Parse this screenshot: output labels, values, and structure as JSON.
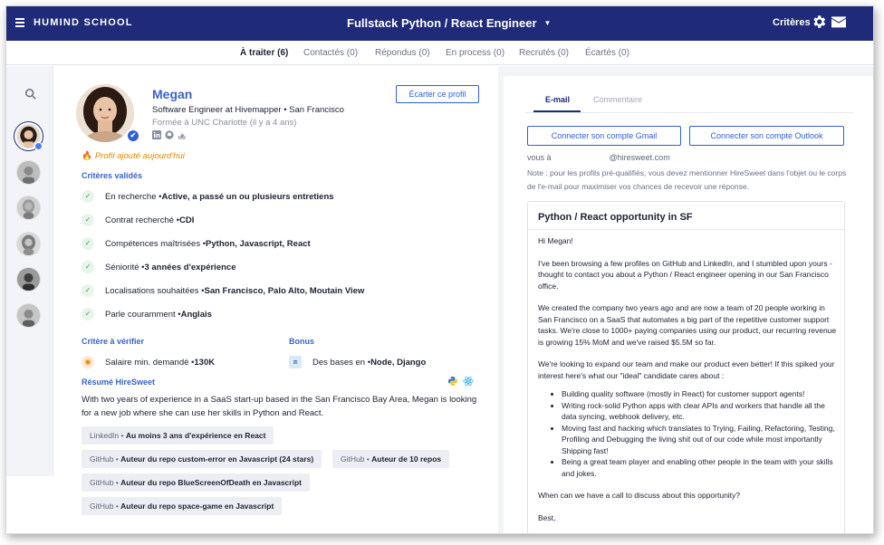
{
  "topbar": {
    "brand": "HUMIND SCHOOL",
    "job_title": "Fullstack Python / React Engineer",
    "criteres_label": "Critères",
    "icons": [
      "menu-icon",
      "chevron-down-icon",
      "gear-icon",
      "mail-icon"
    ],
    "bg_color": "#1f2a78"
  },
  "tabs": [
    {
      "label": "À traiter (6)"
    },
    {
      "label": "Contactés (0)"
    },
    {
      "label": "Répondus (0)"
    },
    {
      "label": "En process (0)"
    },
    {
      "label": "Recrutés (0)"
    },
    {
      "label": "Écartés (0)"
    }
  ],
  "profile": {
    "name": "Megan",
    "headline": "Software Engineer at Hivemapper • San Francisco",
    "education": "Formée à UNC Charlotte (il y a 4 ans)",
    "ecarter_label": "Écarter ce profil",
    "added_label": "Profil ajouté aujourd'hui",
    "validated_title": "Critères validés",
    "validated": [
      {
        "label": "En recherche • ",
        "value": "Active, a passé un ou plusieurs entretiens"
      },
      {
        "label": "Contrat recherché • ",
        "value": "CDI"
      },
      {
        "label": "Compétences maîtrisées • ",
        "value": "Python, Javascript, React"
      },
      {
        "label": "Séniorité • ",
        "value": "3 années d'expérience"
      },
      {
        "label": "Localisations souhaitées • ",
        "value": "San Francisco, Palo Alto, Moutain View"
      },
      {
        "label": "Parle couramment • ",
        "value": "Anglais"
      }
    ],
    "to_verify_title": "Critère à vérifier",
    "to_verify": {
      "label": "Salaire min. demandé • ",
      "value": "130K"
    },
    "bonus_title": "Bonus",
    "bonus": {
      "label": "Des bases en • ",
      "value": "Node, Django"
    },
    "summary_title": "Résumé HireSweet",
    "summary": "With two years of experience in a SaaS start-up based in the San Francisco Bay Area, Megan is looking for a new job where she can use her skills in Python and React.",
    "chips": [
      {
        "source": "LinkedIn • ",
        "text": "Au moins 3 ans d'expérience en React"
      },
      {
        "source": "GitHub • ",
        "text": "Auteur du repo custom-error en Javascript (24 stars)"
      },
      {
        "source": "GitHub • ",
        "text": "Auteur de 10 repos"
      },
      {
        "source": "GitHub • ",
        "text": "Auteur du repo BlueScreenOfDeath en Javascript"
      },
      {
        "source": "GitHub • ",
        "text": "Auteur du repo space-game en Javascript"
      }
    ]
  },
  "email_panel": {
    "tab_email": "E-mail",
    "tab_comment": "Commentaire",
    "connect_gmail": "Connecter son compte Gmail",
    "connect_outlook": "Connecter son compte Outlook",
    "vous_prefix": "vous à",
    "vous_suffix": "@hiresweet.com",
    "note": "Note : pour les profils pré-qualifiés, vous devez mentionner HireSweet dans l'objet ou le corps de l'e-mail pour maximiser vos chances de recevoir une réponse.",
    "subject": "Python / React opportunity in SF",
    "greeting": "Hi Megan!",
    "para1": "I've been browsing a few profiles on GitHub and LinkedIn, and I stumbled upon yours - thought to contact you about a Python / React engineer opening in our San Francisco office.",
    "para2": "We created the company two years ago and are now a team of 20 people working in San Francisco on a SaaS that automates a big part of the repetitive customer support tasks. We're close to 1000+ paying companies using our product, our recurring revenue is growing 15% MoM and we've raised $5.5M so far.",
    "para3": "We're looking to expand our team and make our product even better! If this spiked your interest here's what our \"ideal\" candidate cares about :",
    "bullets": [
      "Building quality software (mostly in React) for customer support agents!",
      "Writing rock-solid Python apps with clear APIs and workers that handle all the data syncing, webhook delivery, etc.",
      "Moving fast and hacking which translates to Trying, Failing, Refactoring, Testing, Profiling and Debugging the living shit out of our code while most importantly Shipping fast!",
      "Being a great team player and enabling other people in the team with your skills and jokes."
    ],
    "closing_q": "When can we have a call to discuss about this opportunity?",
    "signoff": "Best,"
  }
}
